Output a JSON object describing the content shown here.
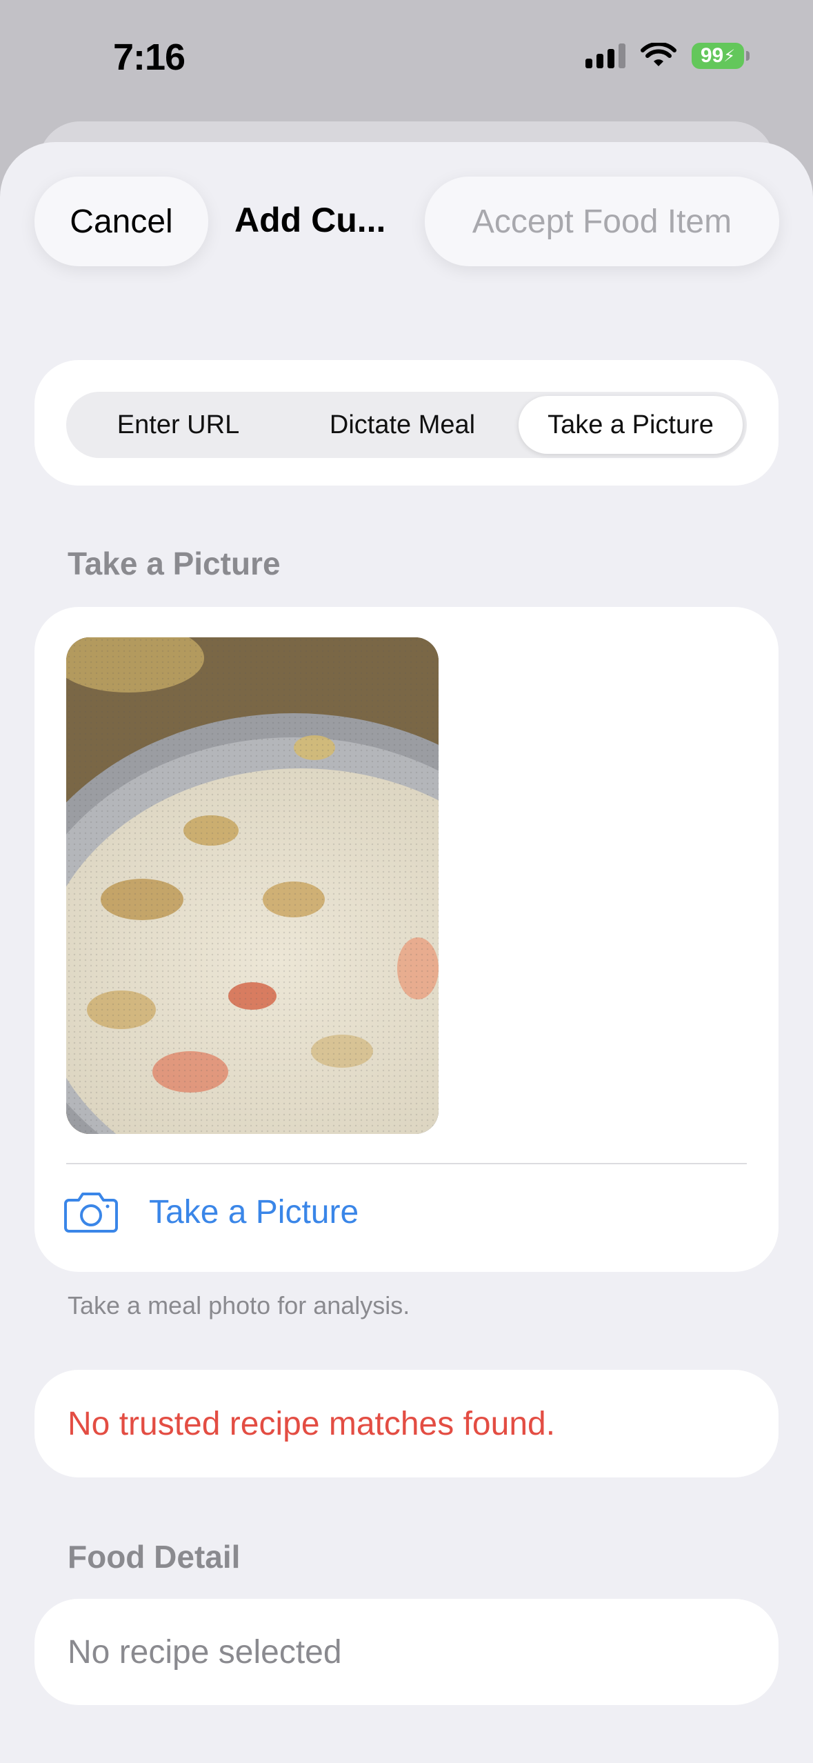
{
  "status_bar": {
    "time": "7:16",
    "battery": "99"
  },
  "nav": {
    "cancel_label": "Cancel",
    "title": "Add Cu...",
    "accept_label": "Accept Food Item"
  },
  "segmented": {
    "options": [
      "Enter URL",
      "Dictate Meal",
      "Take a Picture"
    ],
    "selected": "Take a Picture"
  },
  "picture_section": {
    "header": "Take a Picture",
    "action_label": "Take a Picture",
    "footer": "Take a meal photo for analysis."
  },
  "match_status": "No trusted recipe matches found.",
  "food_detail": {
    "header": "Food Detail",
    "value": "No recipe selected"
  },
  "colors": {
    "accent": "#3a86e8",
    "error": "#e34d43",
    "battery": "#63c75b"
  }
}
